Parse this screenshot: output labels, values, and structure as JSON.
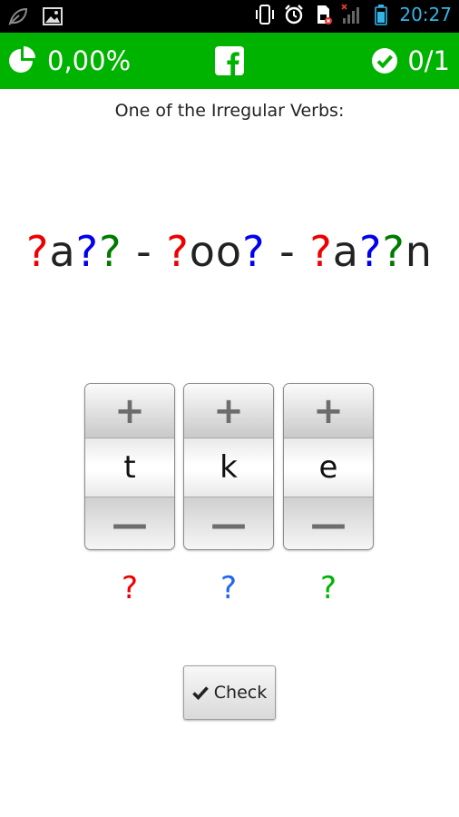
{
  "status_bar": {
    "time": "20:27",
    "icons": [
      "leaf-icon",
      "image-icon",
      "vibrate-icon",
      "alarm-icon",
      "sim-card-icon",
      "signal-icon",
      "battery-icon"
    ]
  },
  "header": {
    "percentage": "0,00%",
    "score": "0/1",
    "icons": {
      "left": "pie-chart-icon",
      "center": "facebook-icon",
      "right": "check-circle-icon"
    },
    "colors": {
      "background": "#00b300"
    }
  },
  "prompt": "One of the Irregular Verbs:",
  "puzzle": {
    "segments": [
      {
        "text": "?",
        "color": "#ee0000"
      },
      {
        "text": "a",
        "color": "#222222"
      },
      {
        "text": "?",
        "color": "#0000ee"
      },
      {
        "text": "?",
        "color": "#007a00"
      },
      {
        "text": " - ",
        "color": "#222222"
      },
      {
        "text": "?",
        "color": "#ee0000"
      },
      {
        "text": "oo",
        "color": "#222222"
      },
      {
        "text": "?",
        "color": "#0000ee"
      },
      {
        "text": " - ",
        "color": "#222222"
      },
      {
        "text": "?",
        "color": "#ee0000"
      },
      {
        "text": "a",
        "color": "#222222"
      },
      {
        "text": "?",
        "color": "#0000ee"
      },
      {
        "text": "?",
        "color": "#007a00"
      },
      {
        "text": "n",
        "color": "#222222"
      }
    ]
  },
  "spinners": [
    {
      "plus": "+",
      "value": "t",
      "minus": "—",
      "hint": "?",
      "hint_color": "#ee0000"
    },
    {
      "plus": "+",
      "value": "k",
      "minus": "—",
      "hint": "?",
      "hint_color": "#2266ee"
    },
    {
      "plus": "+",
      "value": "e",
      "minus": "—",
      "hint": "?",
      "hint_color": "#00b300"
    }
  ],
  "check_button": {
    "label": "Check",
    "icon": "checkmark-icon"
  }
}
